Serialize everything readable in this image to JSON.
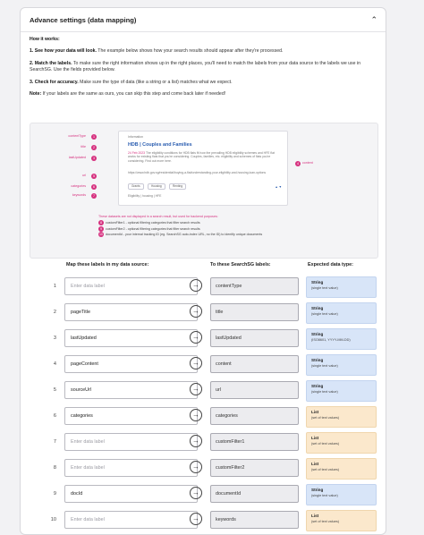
{
  "header": {
    "title": "Advance settings (data mapping)",
    "collapse_icon": "chevron-up-icon"
  },
  "instructions": {
    "heading": "How it works:",
    "step1_bold": "1. See how your data will look.",
    "step1_text": " The example below shows how your search results should appear after they're processed.",
    "step2_bold": "2. Match the labels.",
    "step2_text": " To make sure the right information shows up in the right places, you'll need to match the labels from your data source to the labels we use in SearchSG. Use the fields provided below.",
    "step3_bold": "3. Check for accuracy.",
    "step3_text": " Make sure the type of data (like a string or a list) matches what we expect.",
    "note_bold": "Note:",
    "note_text": " If your labels are the same as ours, you can skip this step and come back later if needed!"
  },
  "example": {
    "labels": [
      "contentType",
      "title",
      "lastUpdated",
      "url",
      "categories",
      "keywords"
    ],
    "content_label": "content",
    "sample_type": "Information",
    "sample_title": "HDB | Couples and Families",
    "sample_date": "24 Feb 2023",
    "sample_body": "The eligibility conditions for HDB flats fit how the prevailing HDB eligibility schemes and HFE flat works for existing flats that you're considering. Couples, families, etc. eligibility and schemes of flats you're considering. Find out more here.",
    "sample_url": "https://www.hdb.gov.sg/residential/buying-a-flat/understanding-your-eligibility-and-housing-loan-options",
    "sample_chips": [
      "Grants",
      "Housing",
      "Renting"
    ],
    "sample_keywords": "Eligibility | housing | HFE",
    "notes_intro": "These datasets are not displayed in a search result, but used for backend purposes:",
    "notes": [
      "customFilter1 - optional filtering categories that filter search results",
      "customFilter2 - optional filtering categories that filter search results",
      "documentId - your internal tracking ID (eg. SearchSG auto-index URL, no the ID) to identify unique documents"
    ]
  },
  "columns": {
    "source": "Map these labels in my data source:",
    "target": "To these SearchSG labels:",
    "type": "Expected data type:"
  },
  "rows": [
    {
      "num": "1",
      "value": "",
      "placeholder": "Enter data label",
      "target": "contentType",
      "type": "String",
      "type_note": "(single text value)",
      "kind": "string"
    },
    {
      "num": "2",
      "value": "pageTitle",
      "placeholder": "Enter data label",
      "target": "title",
      "type": "String",
      "type_note": "(single text value)",
      "kind": "string"
    },
    {
      "num": "3",
      "value": "lastUpdated",
      "placeholder": "Enter data label",
      "target": "lastUpdated",
      "type": "String",
      "type_note": "(ISO8601, YYYY-MM-DD)",
      "kind": "string"
    },
    {
      "num": "4",
      "value": "pageContent",
      "placeholder": "Enter data label",
      "target": "content",
      "type": "String",
      "type_note": "(single text value)",
      "kind": "string"
    },
    {
      "num": "5",
      "value": "sourceUrl",
      "placeholder": "Enter data label",
      "target": "url",
      "type": "String",
      "type_note": "(single text value)",
      "kind": "string"
    },
    {
      "num": "6",
      "value": "categories",
      "placeholder": "Enter data label",
      "target": "categories",
      "type": "List",
      "type_note": "(set of text values)",
      "kind": "list"
    },
    {
      "num": "7",
      "value": "",
      "placeholder": "Enter data label",
      "target": "customFilter1",
      "type": "List",
      "type_note": "(set of text values)",
      "kind": "list"
    },
    {
      "num": "8",
      "value": "",
      "placeholder": "Enter data label",
      "target": "customFilter2",
      "type": "List",
      "type_note": "(set of text values)",
      "kind": "list"
    },
    {
      "num": "9",
      "value": "docId",
      "placeholder": "Enter data label",
      "target": "documentId",
      "type": "String",
      "type_note": "(single text value)",
      "kind": "string"
    },
    {
      "num": "10",
      "value": "",
      "placeholder": "Enter data label",
      "target": "keywords",
      "type": "List",
      "type_note": "(set of text values)",
      "kind": "list"
    }
  ],
  "colors": {
    "accent_pink": "#d6317f",
    "link_blue": "#2a5db0",
    "string_bg": "#d8e5f8",
    "list_bg": "#fbe8cc"
  }
}
